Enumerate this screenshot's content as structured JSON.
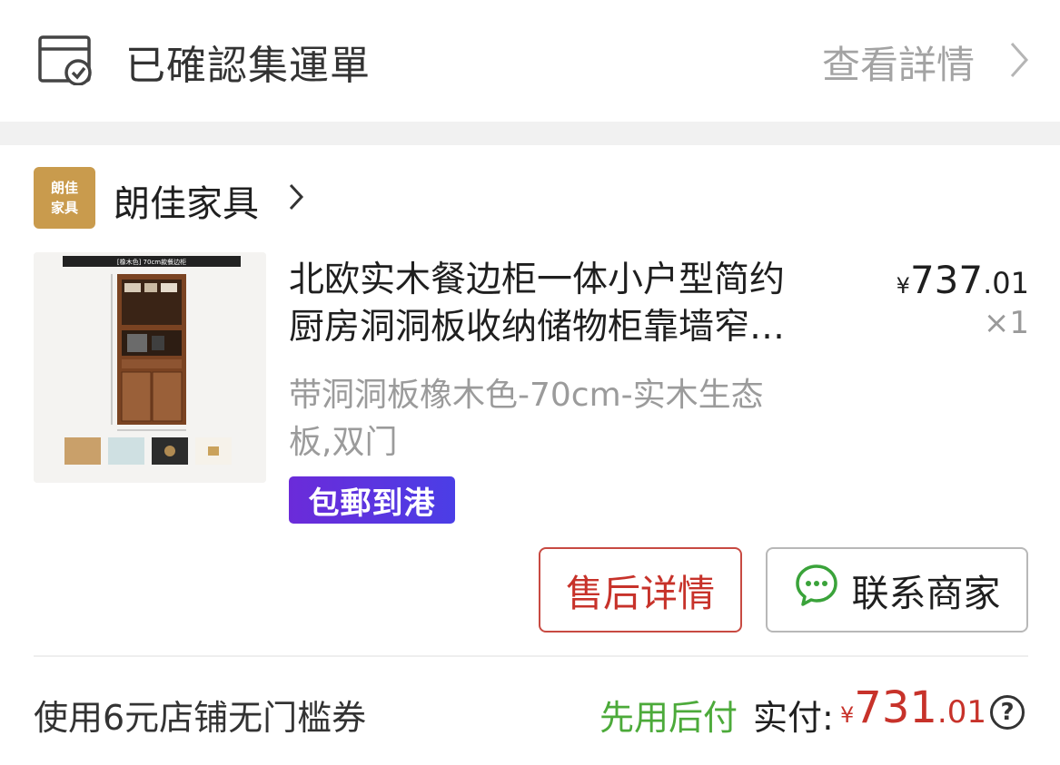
{
  "header": {
    "title": "已確認集運單",
    "details_link": "查看詳情",
    "icon": "shipping-box-check-icon"
  },
  "shop": {
    "logo_line1": "朗佳",
    "logo_line2": "家具",
    "name": "朗佳家具",
    "logo_color": "#c99b4d"
  },
  "product": {
    "title_line1": "北欧实木餐边柜一体小户型简约",
    "title_line2": "厨房洞洞板收纳储物柜靠墙窄…",
    "spec_line1": "带洞洞板橡木色-70cm-实木生态",
    "spec_line2": "板,双门",
    "price_symbol": "¥",
    "price_int": "737",
    "price_dec": ".01",
    "quantity": "×1",
    "badge": "包郵到港",
    "image_caption": "[橡木色] 70cm款餐边柜"
  },
  "actions": {
    "after_sales": "售后详情",
    "contact": "联系商家"
  },
  "summary": {
    "coupon": "使用6元店铺无门槛券",
    "pay_later": "先用后付",
    "paid_label": "实付:",
    "paid_symbol": "¥",
    "paid_int": "731",
    "paid_dec": ".01",
    "help": "?"
  },
  "colors": {
    "accent_red": "#c7322a",
    "pay_later_green": "#4caa3a",
    "badge_purple": "#5a35e0"
  }
}
